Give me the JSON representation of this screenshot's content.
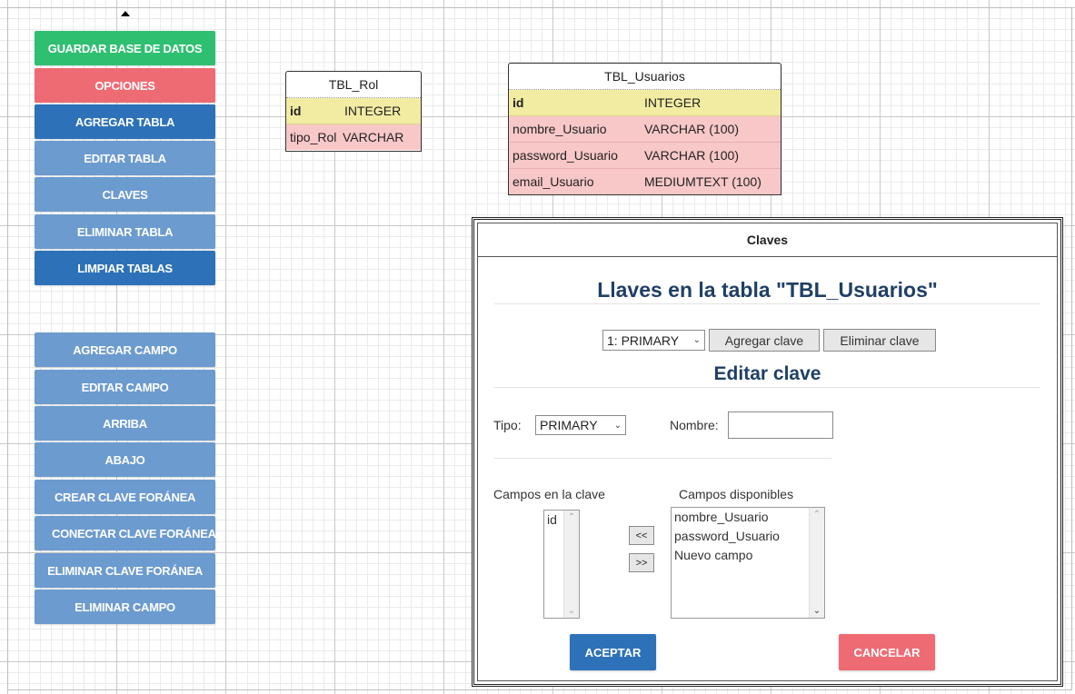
{
  "toolbar": {
    "save_db": "GUARDAR BASE DE DATOS",
    "options": "OPCIONES",
    "add_table": "AGREGAR TABLA",
    "edit_table": "EDITAR TABLA",
    "keys": "CLAVES",
    "delete_table": "ELIMINAR TABLA",
    "clear_tables": "LIMPIAR TABLAS",
    "add_field": "AGREGAR CAMPO",
    "edit_field": "EDITAR CAMPO",
    "up": "ARRIBA",
    "down": "ABAJO",
    "create_fk": "CREAR CLAVE FORÁNEA",
    "connect_fk": "CONECTAR CLAVE FORÁNEA",
    "delete_fk": "ELIMINAR CLAVE FORÁNEA",
    "delete_field": "ELIMINAR CAMPO"
  },
  "tables": {
    "rol": {
      "title": "TBL_Rol",
      "rows": [
        {
          "name": "id",
          "type": "INTEGER"
        },
        {
          "name": "tipo_Rol",
          "type": "VARCHAR"
        }
      ]
    },
    "usuarios": {
      "title": "TBL_Usuarios",
      "rows": [
        {
          "name": "id",
          "type": "INTEGER"
        },
        {
          "name": "nombre_Usuario",
          "type": "VARCHAR (100)"
        },
        {
          "name": "password_Usuario",
          "type": "VARCHAR (100)"
        },
        {
          "name": "email_Usuario",
          "type": "MEDIUMTEXT (100)"
        }
      ]
    }
  },
  "dialog": {
    "header": "Claves",
    "title": "Llaves en la tabla \"TBL_Usuarios\"",
    "key_select": "1: PRIMARY",
    "add_key": "Agregar clave",
    "delete_key": "Eliminar clave",
    "edit_title": "Editar clave",
    "type_label": "Tipo:",
    "type_value": "PRIMARY",
    "name_label": "Nombre:",
    "name_value": "",
    "fields_in_key_label": "Campos en la clave",
    "fields_in_key": [
      "id"
    ],
    "available_label": "Campos disponibles",
    "available_fields": [
      "nombre_Usuario",
      "password_Usuario",
      "Nuevo campo"
    ],
    "move_left": "<<",
    "move_right": ">>",
    "accept": "ACEPTAR",
    "cancel": "CANCELAR"
  },
  "colors": {
    "green": "#2fbf71",
    "red": "#ef6b73",
    "blue": "#2d72b8",
    "light_blue": "#6c9bcf",
    "pk_row": "#f2eba2",
    "field_row": "#f8c7c7",
    "title_text": "#1f3f66"
  }
}
